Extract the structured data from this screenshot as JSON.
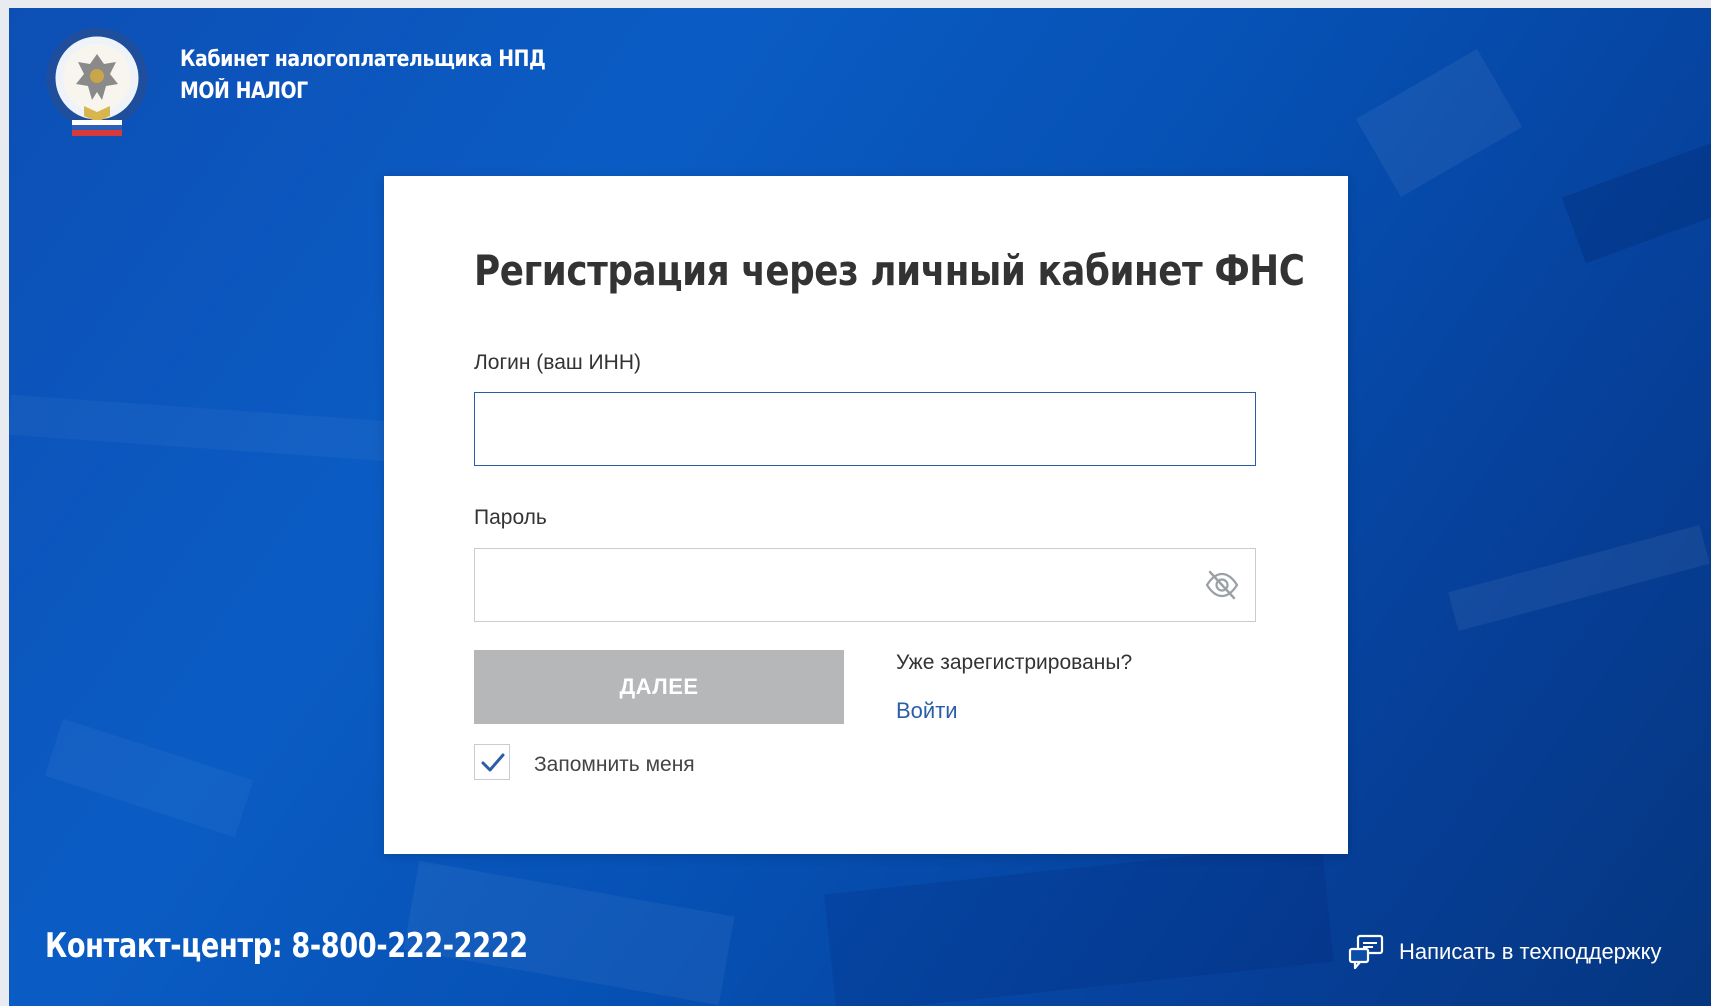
{
  "header": {
    "title_line1": "Кабинет налогоплательщика НПД",
    "title_line2": "МОЙ НАЛОГ",
    "logo_icon": "fns-emblem-icon"
  },
  "form": {
    "title": "Регистрация через личный кабинет ФНС",
    "login_label": "Логин (ваш ИНН)",
    "login_value": "",
    "password_label": "Пароль",
    "password_value": "",
    "password_toggle_icon": "eye-off-icon",
    "next_button": "ДАЛЕЕ",
    "already_registered": "Уже зарегистрированы?",
    "login_link": "Войти",
    "remember_me": "Запомнить меня",
    "remember_checked": true
  },
  "footer": {
    "contact": "Контакт-центр: 8-800-222-2222",
    "support": "Написать в техподдержку",
    "support_icon": "chat-support-icon"
  },
  "colors": {
    "background": "#0a5cc4",
    "link": "#2b5ea8",
    "button_disabled": "#b6b7b9",
    "input_focus_border": "#2c5aa5"
  }
}
